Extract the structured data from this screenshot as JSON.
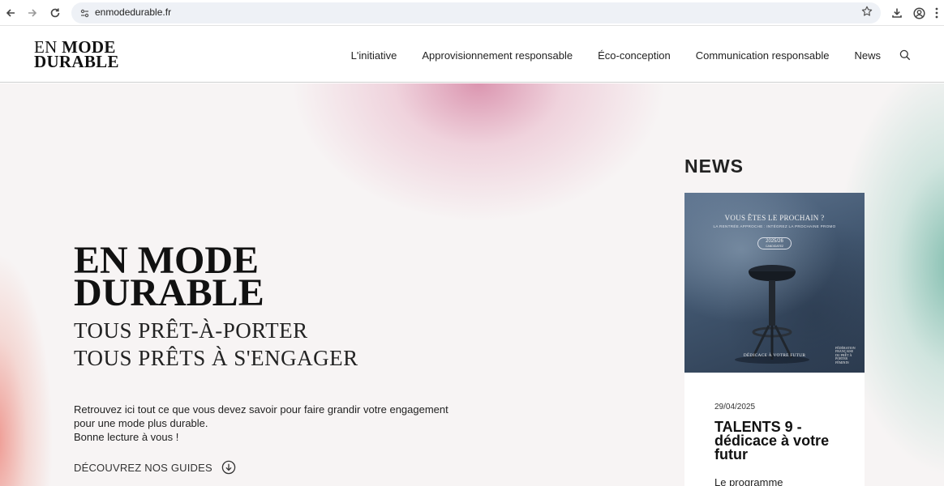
{
  "browser": {
    "url": "enmodedurable.fr",
    "icons": [
      "arrow-left-icon",
      "arrow-right-icon",
      "reload-icon",
      "site-info-icon",
      "star-icon",
      "download-icon",
      "profile-icon",
      "menu-icon"
    ]
  },
  "header": {
    "logo_line1_a": "EN",
    "logo_line1_b": "MODE",
    "logo_line2": "DURABLE",
    "nav": [
      {
        "label": "L'initiative"
      },
      {
        "label": "Approvisionnement responsable"
      },
      {
        "label": "Éco-conception"
      },
      {
        "label": "Communication responsable"
      },
      {
        "label": "News"
      }
    ]
  },
  "hero": {
    "title_a": "EN",
    "title_b": "MODE",
    "title_line2": "DURABLE",
    "subtitle_1": "TOUS PRÊT-À-PORTER",
    "subtitle_2": "TOUS PRÊTS À S'ENGAGER",
    "body_line1": "Retrouvez ici tout ce que vous devez savoir pour faire grandir votre engagement pour une mode plus durable.",
    "body_line2": "Bonne lecture à vous !",
    "cta_label": "DÉCOUVREZ NOS GUIDES"
  },
  "news": {
    "heading": "NEWS",
    "card": {
      "image": {
        "headline": "VOUS ÊTES LE PROCHAIN ?",
        "subline": "LA RENTRÉE APPROCHE : INTÉGREZ LA PROCHAINE PROMO",
        "pill_year": "2025/26",
        "pill_sub": "CANDIDATEZ",
        "footer": "DÉDICACE À VOTRE FUTUR",
        "federation": "FÉDÉRATION FRANÇAISE DU PRÊT À PORTER FÉMININ"
      },
      "date": "29/04/2025",
      "title": "TALENTS 9 - dédicace à votre futur",
      "excerpt": "Le programme"
    }
  },
  "colors": {
    "accent_pink": "#d685a4",
    "accent_teal": "#58aa96",
    "accent_coral": "#ec8278",
    "text": "#1a1a1a"
  }
}
